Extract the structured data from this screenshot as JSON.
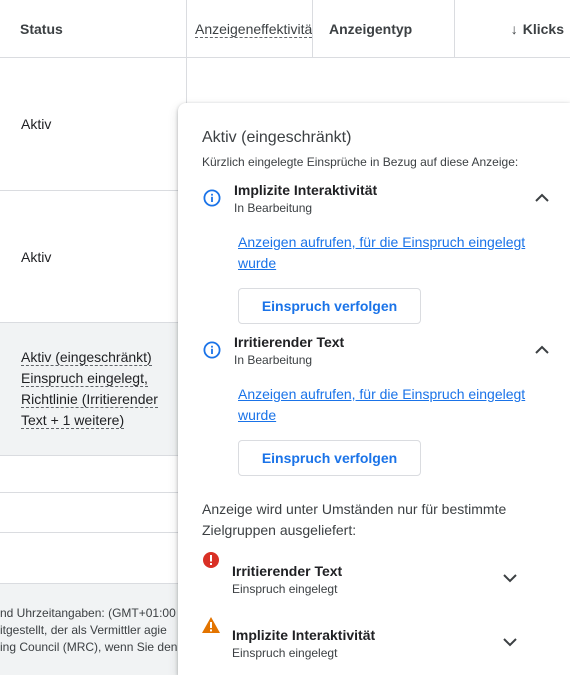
{
  "table": {
    "headers": {
      "status": "Status",
      "effectiveness": "Anzeigeneffektivität",
      "type": "Anzeigentyp",
      "clicks": "Klicks",
      "sort_arrow": "↓"
    },
    "rows": [
      {
        "status": "Aktiv"
      },
      {
        "status": "Aktiv"
      },
      {
        "status_lines": [
          "Aktiv (eingeschränkt)",
          "Einspruch eingelegt,",
          "Richtlinie (Irritierender",
          "Text + 1 weitere)"
        ]
      }
    ],
    "footer_lines": [
      "nd Uhrzeitangaben: (GMT+01:00",
      "itgestellt, der als Vermittler agie",
      "ing Council (MRC), wenn Sie den"
    ]
  },
  "popover": {
    "title": "Aktiv (eingeschränkt)",
    "subtitle": "Kürzlich eingelegte Einsprüche in Bezug auf diese Anzeige:",
    "appeals": [
      {
        "icon": "info-icon",
        "title": "Implizite Interaktivität",
        "status": "In Bearbeitung",
        "link": "Anzeigen aufrufen, für die Einspruch eingelegt wurde",
        "button": "Einspruch verfolgen",
        "expanded": true
      },
      {
        "icon": "info-icon",
        "title": "Irritierender Text",
        "status": "In Bearbeitung",
        "link": "Anzeigen aufrufen, für die Einspruch eingelegt wurde",
        "button": "Einspruch verfolgen",
        "expanded": true
      }
    ],
    "limited_text": "Anzeige wird unter Umständen nur für bestimmte Zielgruppen ausgeliefert:",
    "policies": [
      {
        "icon": "error-icon",
        "title": "Irritierender Text",
        "status": "Einspruch eingelegt",
        "expanded": false
      },
      {
        "icon": "warning-icon",
        "title": "Implizite Interaktivität",
        "status": "Einspruch eingelegt",
        "expanded": false
      }
    ]
  },
  "colors": {
    "link": "#1a73e8",
    "info": "#1a73e8",
    "error": "#d93025",
    "warning": "#e37400",
    "row_highlight": "#f1f3f4"
  }
}
